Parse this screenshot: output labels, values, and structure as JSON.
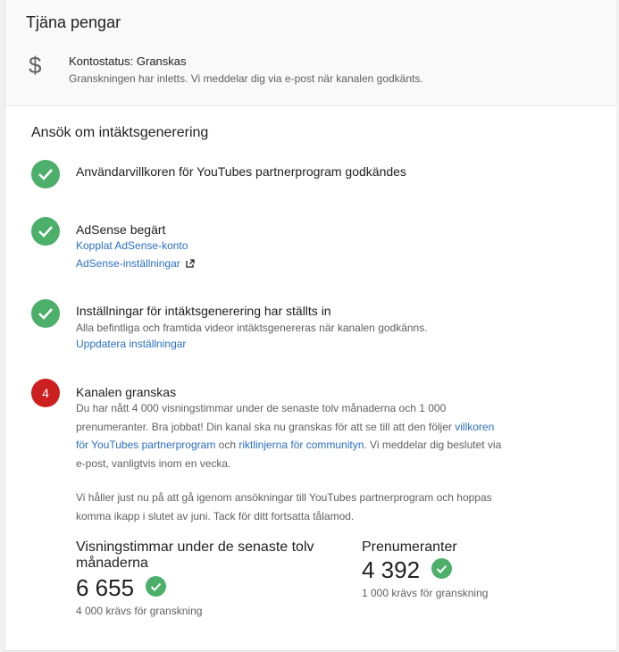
{
  "header": {
    "title": "Tjäna pengar",
    "dollar_icon": "dollar-icon",
    "status": "Kontostatus: Granskas",
    "status_desc": "Granskningen har inletts. Vi meddelar dig via e-post när kanalen godkänts."
  },
  "apply": {
    "title": "Ansök om intäktsgenerering"
  },
  "steps": [
    {
      "title": "Användarvillkoren för YouTubes partnerprogram godkändes",
      "icon": "check-icon"
    },
    {
      "title": "AdSense begärt",
      "link1": "Kopplat AdSense-konto",
      "link2": "AdSense-inställningar",
      "link2_icon": "external-link-icon",
      "icon": "check-icon"
    },
    {
      "title": "Inställningar för intäktsgenerering har ställts in",
      "desc": "Alla befintliga och framtida videor intäktsgenereras när kanalen godkänns.",
      "link": "Uppdatera inställningar",
      "icon": "check-icon"
    },
    {
      "number": "4",
      "title": "Kanalen granskas",
      "para1_a": "Du har nått 4 000 visningstimmar under de senaste tolv månaderna och 1 000 prenumeranter. Bra jobbat! Din kanal ska nu granskas för att se till att den följer ",
      "para1_link1": "villkoren för YouTubes partnerprogram",
      "para1_b": " och ",
      "para1_link2": "riktlinjerna för communityn",
      "para1_c": ". Vi meddelar dig beslutet via e-post, vanligtvis inom en vecka.",
      "para2": "Vi håller just nu på att gå igenom ansökningar till YouTubes partnerprogram och hoppas komma ikapp i slutet av juni. Tack för ditt fortsatta tålamod."
    }
  ],
  "stats": {
    "watch_label": "Visningstimmar under de senaste tolv månaderna",
    "watch_value": "6 655",
    "watch_req": "4 000 krävs för granskning",
    "subs_label": "Prenumeranter",
    "subs_value": "4 392",
    "subs_req": "1 000 krävs för granskning"
  },
  "colors": {
    "check_green": "#4caf6a",
    "step_red": "#cc1f1f",
    "link_blue": "#2b6fc2"
  }
}
